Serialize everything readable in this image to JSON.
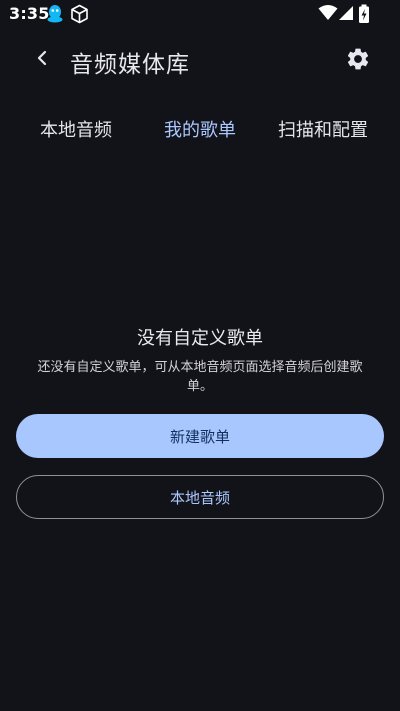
{
  "status_bar": {
    "time": "3:35",
    "icons": [
      "qq-icon",
      "package-icon",
      "wifi-icon",
      "signal-icon",
      "battery-charging-icon"
    ]
  },
  "app_bar": {
    "title": "音频媒体库",
    "back_icon": "chevron-left-icon",
    "settings_icon": "gear-icon"
  },
  "tabs": [
    {
      "label": "本地音频",
      "active": false
    },
    {
      "label": "我的歌单",
      "active": true
    },
    {
      "label": "扫描和配置",
      "active": false
    }
  ],
  "empty_state": {
    "title": "没有自定义歌单",
    "description": "还没有自定义歌单，可从本地音频页面选择音频后创建歌单。"
  },
  "actions": {
    "create_playlist_label": "新建歌单",
    "local_audio_label": "本地音频"
  },
  "colors": {
    "background": "#121318",
    "accent": "#aac7ff",
    "primary_button": "#a9c7ff",
    "primary_button_text": "#11305e"
  }
}
